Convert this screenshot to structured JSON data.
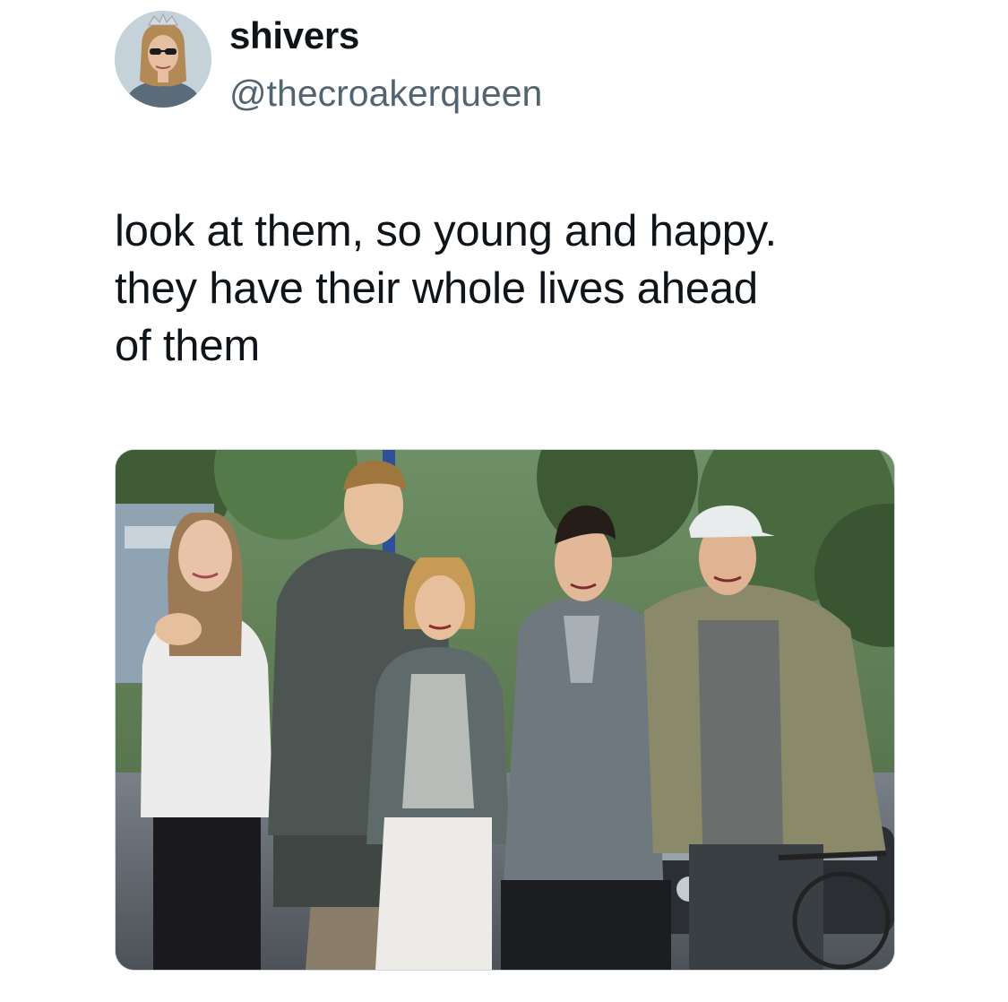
{
  "tweet": {
    "author": {
      "display_name": "shivers",
      "handle": "@thecroakerqueen",
      "avatar_icon": "user-avatar"
    },
    "text_lines": [
      "look at them, so young and happy.",
      "they have their whole lives ahead",
      "of them"
    ],
    "media": {
      "type": "photo",
      "icon": "group-photo"
    }
  },
  "colors": {
    "text_primary": "#0f1419",
    "text_secondary": "#536471",
    "background": "#ffffff",
    "media_border": "#cfd9de"
  }
}
